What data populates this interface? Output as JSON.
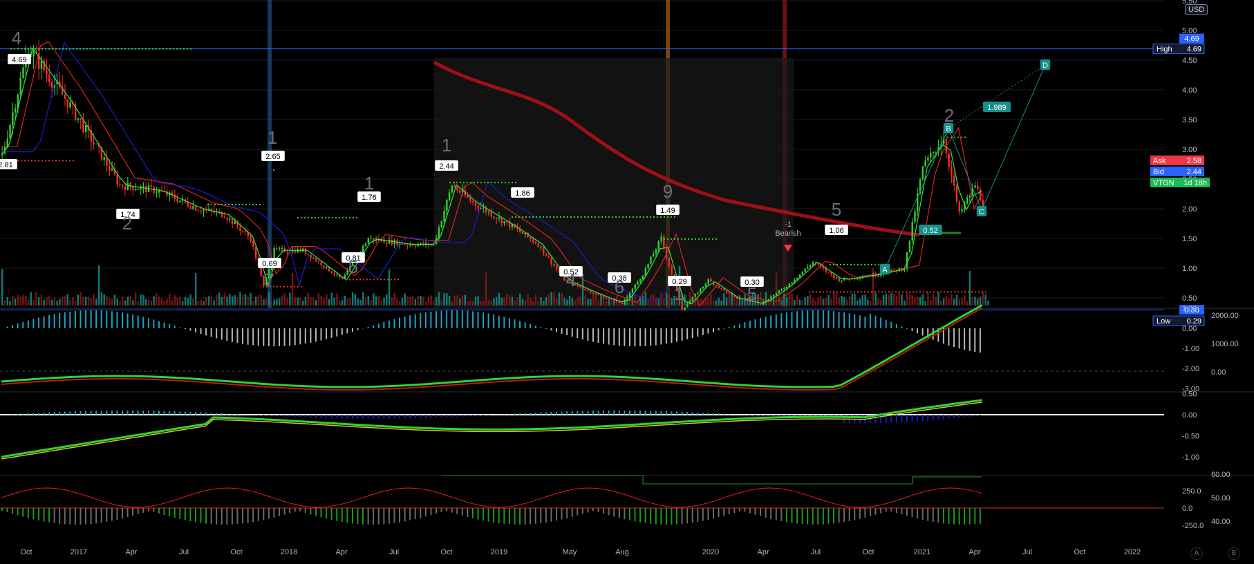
{
  "currency": "USD",
  "corner_buttons": [
    "A",
    "B"
  ],
  "colors": {
    "bg": "#000000",
    "up": "#2bd62b",
    "down": "#ff2b2b",
    "ma_red": "#b0101a",
    "ma_blue": "#1a1ac8",
    "teal": "#14918b",
    "accent_blue": "#2962ff"
  },
  "chart_data": [
    {
      "type": "candlestick",
      "symbol": "VTGN",
      "title": "",
      "ylabel": "",
      "ylim": [
        0,
        5.9
      ],
      "y_ticks": [
        "5.50",
        "5.00",
        "4.50",
        "4.00",
        "3.50",
        "3.00",
        "2.50",
        "2.00",
        "1.50",
        "1.00",
        "0.50"
      ],
      "x_ticks": [
        "Oct",
        "2017",
        "Apr",
        "Jul",
        "Oct",
        "2018",
        "Apr",
        "Jul",
        "Oct",
        "2019",
        "May",
        "Aug",
        "2020",
        "Apr",
        "Jul",
        "Oct",
        "2021",
        "Apr",
        "Jul",
        "Oct",
        "2022"
      ],
      "close_series": [
        [
          0,
          2.9
        ],
        [
          10,
          4.7
        ],
        [
          25,
          3.8
        ],
        [
          45,
          2.4
        ],
        [
          60,
          2.3
        ],
        [
          75,
          2.0
        ],
        [
          85,
          1.9
        ],
        [
          95,
          1.5
        ],
        [
          100,
          0.7
        ],
        [
          104,
          1.3
        ],
        [
          115,
          1.3
        ],
        [
          130,
          0.8
        ],
        [
          140,
          1.5
        ],
        [
          155,
          1.4
        ],
        [
          165,
          1.4
        ],
        [
          172,
          2.4
        ],
        [
          180,
          2.1
        ],
        [
          195,
          1.7
        ],
        [
          205,
          1.4
        ],
        [
          215,
          0.8
        ],
        [
          225,
          0.6
        ],
        [
          237,
          0.4
        ],
        [
          245,
          0.9
        ],
        [
          252,
          1.5
        ],
        [
          260,
          0.3
        ],
        [
          270,
          0.8
        ],
        [
          280,
          0.5
        ],
        [
          290,
          0.4
        ],
        [
          300,
          0.7
        ],
        [
          310,
          1.1
        ],
        [
          320,
          0.8
        ],
        [
          335,
          0.9
        ],
        [
          345,
          1.0
        ],
        [
          352,
          2.7
        ],
        [
          360,
          3.2
        ],
        [
          366,
          1.9
        ],
        [
          372,
          2.4
        ],
        [
          375,
          2.1
        ]
      ],
      "high_marker": {
        "label": "High",
        "value": "4.69"
      },
      "low_marker": {
        "label": "Low",
        "value": "0.29"
      },
      "price_tags": [
        {
          "label": "Ask",
          "value": "2.58",
          "color": "#f23645"
        },
        {
          "label": "Bid",
          "value": "2.44",
          "color": "#2962ff"
        },
        {
          "label": "VTGN",
          "value": "1d 18h",
          "color": "#1db954"
        }
      ],
      "axis_tags": [
        {
          "value": "4.69",
          "color": "#2962ff"
        },
        {
          "value": "0.30",
          "color": "#2962ff"
        }
      ],
      "swing_labels": [
        "4.69",
        "2.81",
        "1.74",
        "2.65",
        "0.69",
        "1.76",
        "0.81",
        "2.44",
        "1.86",
        "0.52",
        "0.38",
        "1.49",
        "0.29",
        "0.30",
        "1.06",
        "0.52"
      ],
      "wave_labels": [
        "4",
        "2",
        "1",
        "7",
        "1",
        "5",
        "1",
        "9",
        "4",
        "6",
        "1",
        "5",
        "5",
        "2"
      ],
      "annotations": [
        "-1",
        "Bearish",
        "1.989",
        "A",
        "B",
        "C",
        "D"
      ]
    },
    {
      "type": "histogram",
      "name": "oscillator-1",
      "y_ticks": [
        "1.00",
        "0.00",
        "-1.00",
        "-2.00",
        "-3.00"
      ],
      "right_ticks": [
        "2000.00",
        "1000.00",
        "0.00"
      ]
    },
    {
      "type": "histogram",
      "name": "oscillator-2",
      "y_ticks": [
        "0.50",
        "0.00",
        "-0.50",
        "-1.00"
      ]
    },
    {
      "type": "histogram",
      "name": "oscillator-3",
      "y_ticks": [
        "250.0",
        "0.0",
        "-250.0"
      ],
      "right_ticks": [
        "60.00",
        "50.00",
        "40.00"
      ]
    }
  ]
}
